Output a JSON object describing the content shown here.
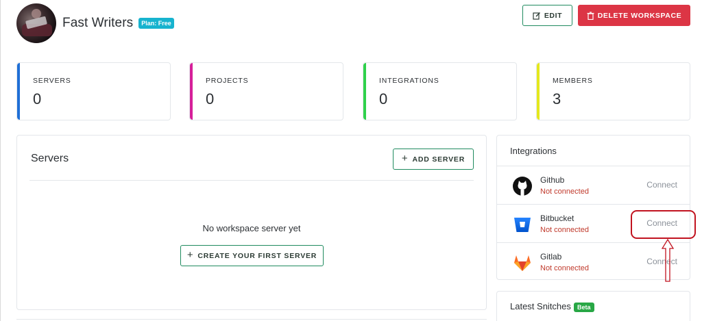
{
  "workspace": {
    "name": "Fast Writers",
    "plan_badge": "Plan: Free"
  },
  "actions": {
    "edit_label": "EDIT",
    "delete_label": "DELETE WORKSPACE"
  },
  "stats": [
    {
      "label": "SERVERS",
      "value": "0",
      "color": "#1f6fd6"
    },
    {
      "label": "PROJECTS",
      "value": "0",
      "color": "#d61f9a"
    },
    {
      "label": "INTEGRATIONS",
      "value": "0",
      "color": "#2fd14b"
    },
    {
      "label": "MEMBERS",
      "value": "3",
      "color": "#e4e81d"
    }
  ],
  "servers_panel": {
    "title": "Servers",
    "add_label": "ADD SERVER",
    "empty_text": "No workspace server yet",
    "create_label": "CREATE YOUR FIRST SERVER"
  },
  "integrations_panel": {
    "title": "Integrations",
    "items": [
      {
        "name": "Github",
        "status": "Not connected",
        "action": "Connect",
        "icon": "github-icon"
      },
      {
        "name": "Bitbucket",
        "status": "Not connected",
        "action": "Connect",
        "icon": "bitbucket-icon"
      },
      {
        "name": "Gitlab",
        "status": "Not connected",
        "action": "Connect",
        "icon": "gitlab-icon"
      }
    ]
  },
  "snitches_panel": {
    "title": "Latest Snitches",
    "badge": "Beta"
  },
  "colors": {
    "accent_green": "#1e8a5e",
    "danger": "#dc3545",
    "plan_badge": "#17b3cf",
    "beta_badge": "#28a745",
    "not_connected": "#c0392b",
    "annotation": "#c1121f"
  }
}
